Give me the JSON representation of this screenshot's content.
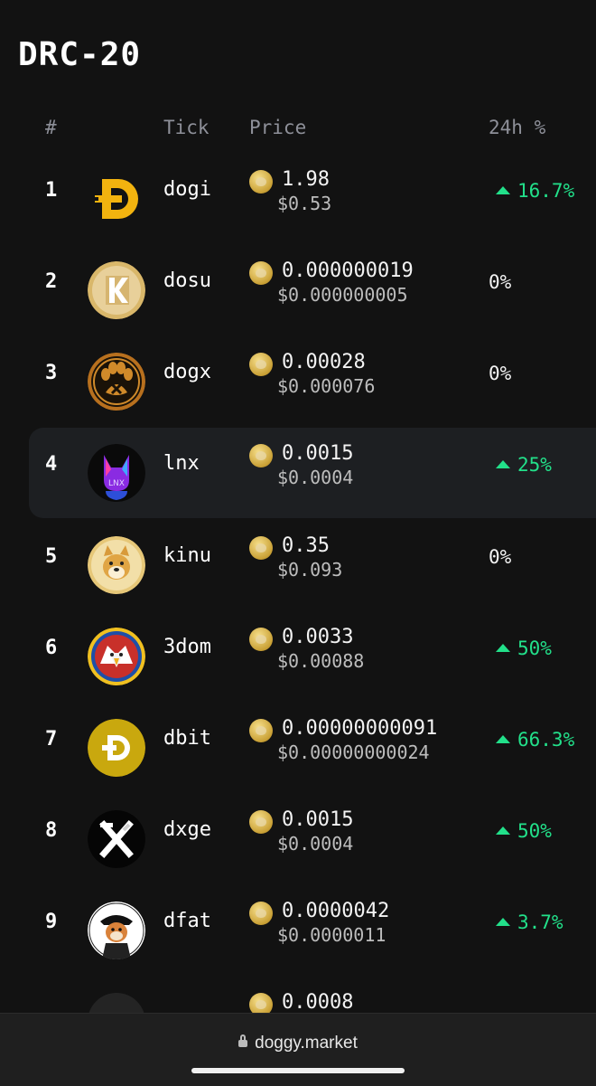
{
  "page": {
    "title": "DRC-20"
  },
  "headers": {
    "rank": "#",
    "tick": "Tick",
    "price": "Price",
    "change": "24h %"
  },
  "rows": [
    {
      "rank": "1",
      "tick": "dogi",
      "price": "1.98",
      "usd": "$0.53",
      "change": "16.7%",
      "direction": "up",
      "logo": "dogi-logo"
    },
    {
      "rank": "2",
      "tick": "dosu",
      "price": "0.000000019",
      "usd": "$0.000000005",
      "change": "0%",
      "direction": "flat",
      "logo": "dosu-logo"
    },
    {
      "rank": "3",
      "tick": "dogx",
      "price": "0.00028",
      "usd": "$0.000076",
      "change": "0%",
      "direction": "flat",
      "logo": "dogx-logo"
    },
    {
      "rank": "4",
      "tick": "lnx",
      "price": "0.0015",
      "usd": "$0.0004",
      "change": "25%",
      "direction": "up",
      "logo": "lnx-logo",
      "logo_text": "LNX"
    },
    {
      "rank": "5",
      "tick": "kinu",
      "price": "0.35",
      "usd": "$0.093",
      "change": "0%",
      "direction": "flat",
      "logo": "kinu-logo"
    },
    {
      "rank": "6",
      "tick": "3dom",
      "price": "0.0033",
      "usd": "$0.00088",
      "change": "50%",
      "direction": "up",
      "logo": "3dom-logo"
    },
    {
      "rank": "7",
      "tick": "dbit",
      "price": "0.00000000091",
      "usd": "$0.00000000024",
      "change": "66.3%",
      "direction": "up",
      "logo": "dbit-logo"
    },
    {
      "rank": "8",
      "tick": "dxge",
      "price": "0.0015",
      "usd": "$0.0004",
      "change": "50%",
      "direction": "up",
      "logo": "dxge-logo"
    },
    {
      "rank": "9",
      "tick": "dfat",
      "price": "0.0000042",
      "usd": "$0.0000011",
      "change": "3.7%",
      "direction": "up",
      "logo": "dfat-logo"
    },
    {
      "rank": "",
      "tick": "",
      "price": "0.0008",
      "usd": "",
      "change": "",
      "direction": "flat",
      "logo": "partial-logo"
    }
  ],
  "browser": {
    "url": "doggy.market"
  },
  "colors": {
    "background": "#121212",
    "positive": "#22e08a",
    "highlight_row": "#1d1f22",
    "muted": "#8e9099"
  }
}
